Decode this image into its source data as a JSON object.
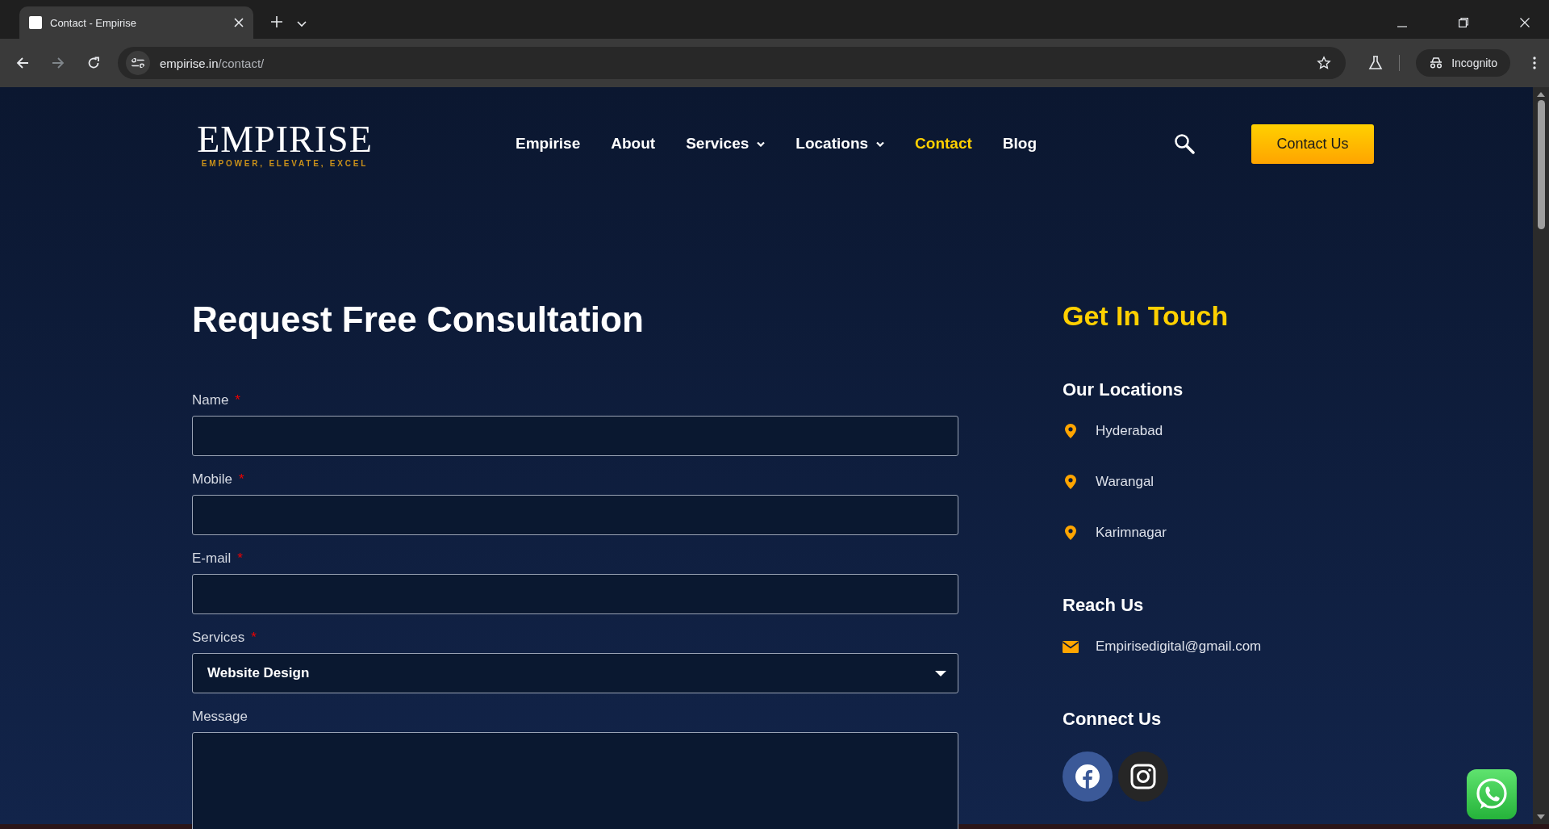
{
  "browser": {
    "tab_title": "Contact - Empirise",
    "url_host": "empirise.in",
    "url_path": "/contact/",
    "profile": "Incognito"
  },
  "header": {
    "logo": "EMPIRISE",
    "tagline": "EMPOWER, ELEVATE, EXCEL",
    "nav": [
      {
        "label": "Empirise",
        "selected": false,
        "has_menu": false
      },
      {
        "label": "About",
        "selected": false,
        "has_menu": false
      },
      {
        "label": "Services",
        "selected": false,
        "has_menu": true
      },
      {
        "label": "Locations",
        "selected": false,
        "has_menu": true
      },
      {
        "label": "Contact",
        "selected": true,
        "has_menu": false
      },
      {
        "label": "Blog",
        "selected": false,
        "has_menu": false
      }
    ],
    "cta": "Contact Us"
  },
  "form": {
    "title": "Request Free Consultation",
    "fields": [
      {
        "label": "Name",
        "required": true,
        "kind": "input"
      },
      {
        "label": "Mobile",
        "required": true,
        "kind": "input"
      },
      {
        "label": "E-mail",
        "required": true,
        "kind": "input"
      },
      {
        "label": "Services",
        "required": true,
        "kind": "select",
        "value": "Website Design"
      },
      {
        "label": "Message",
        "required": false,
        "kind": "textarea"
      }
    ],
    "required_mark": "*"
  },
  "contact": {
    "title": "Get In Touch",
    "sections": [
      {
        "heading": "Our Locations",
        "items": [
          {
            "kind": "pin",
            "text": "Hyderabad"
          },
          {
            "kind": "pin",
            "text": "Warangal"
          },
          {
            "kind": "pin",
            "text": "Karimnagar"
          }
        ]
      },
      {
        "heading": "Reach Us",
        "items": [
          {
            "kind": "mail",
            "text": "Empirisedigital@gmail.com"
          }
        ]
      },
      {
        "heading": "Connect Us",
        "social": [
          {
            "kind": "facebook"
          },
          {
            "kind": "instagram"
          }
        ]
      }
    ]
  }
}
